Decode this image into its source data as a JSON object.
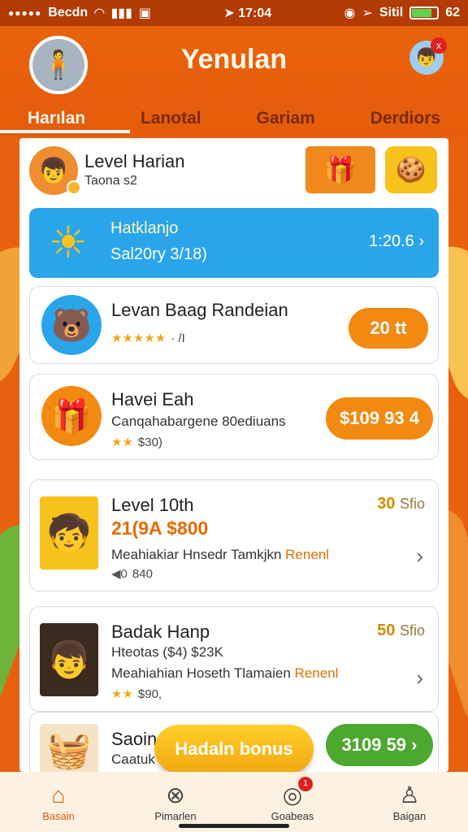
{
  "status_bar": {
    "carrier": "Becdn",
    "time": "17:04",
    "right_text": "Sitil",
    "battery_text": "62"
  },
  "header": {
    "app_title": "Yenulan",
    "tabs": [
      "Harılan",
      "Lanotal",
      "Gariam",
      "Derdiors"
    ],
    "avatar_badge": "x"
  },
  "level": {
    "title": "Level Harian",
    "sub": "Taona s2"
  },
  "blue_card": {
    "title": "Hatklanjo",
    "sub": "Sal20ry 3/18)",
    "value": "1:20.6 ›"
  },
  "cards": [
    {
      "title": "Levan Baag Randeian",
      "stars": "★★★★★",
      "stars_text": "· /I",
      "button": "20 tt"
    },
    {
      "title": "Havei Eah",
      "line": "Canqahabargene 80ediuans",
      "stars": "★★",
      "stars_text": "$30)",
      "button": "$109 93 4"
    },
    {
      "title": "Level 10th",
      "price": "21(9A $800",
      "line_prefix": "Meahiakiar Hnsedr Tamkjkn ",
      "line_highlight": "Renenl",
      "stars": "◀0",
      "stars_text": "840",
      "stat_value": "30",
      "stat_unit": "Sfio",
      "chevron": "›"
    },
    {
      "title": "Badak Hanp",
      "line1": "Hteotas ($4) $23K",
      "line_prefix": "Meahiahian Hoseth Tlamaien ",
      "line_highlight": "Renenl",
      "stars": "★★",
      "stars_text": "$90,",
      "stat_value": "50",
      "stat_unit": "Sfio",
      "chevron": "›"
    },
    {
      "title": "Saoin",
      "line": "Caatuk",
      "button": "3109 59 ›"
    }
  ],
  "float_button": "Hadaln bonus",
  "bottom_nav": [
    {
      "label": "Basain",
      "icon": "⌂"
    },
    {
      "label": "Pimarlen",
      "icon": "⊗"
    },
    {
      "label": "Goabeas",
      "icon": "◎",
      "badge": "1"
    },
    {
      "label": "Baigan",
      "icon": "♙"
    }
  ],
  "colors": {
    "primary": "#e9620d",
    "blue": "#2aa5ea",
    "orange_button": "#f28a12",
    "green_button": "#4da82f"
  }
}
